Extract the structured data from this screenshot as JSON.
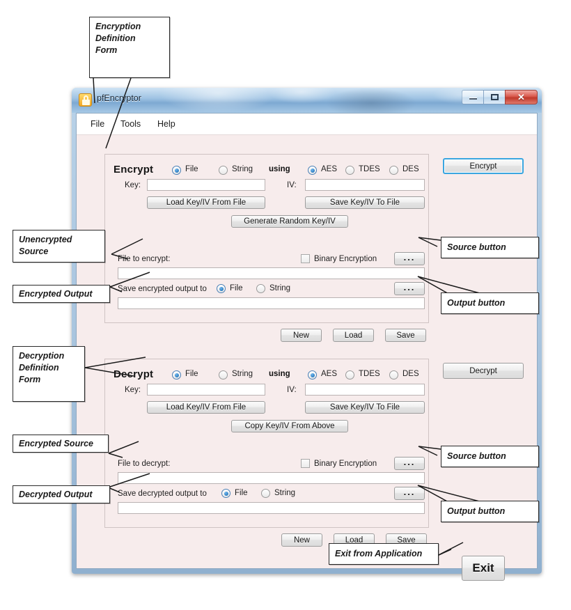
{
  "window": {
    "title": "pfEncryptor",
    "icon": "padlock-icon",
    "controls": {
      "minimize": "–",
      "maximize": "□",
      "close": "✕"
    }
  },
  "menubar": {
    "items": [
      "File",
      "Tools",
      "Help"
    ]
  },
  "encrypt_section": {
    "title": "Encrypt",
    "using_label": "using",
    "source_mode": {
      "options": [
        "File",
        "String"
      ],
      "selected": "File"
    },
    "algorithm": {
      "options": [
        "AES",
        "TDES",
        "DES"
      ],
      "selected": "AES"
    },
    "key_label": "Key:",
    "key_value": "",
    "iv_label": "IV:",
    "iv_value": "",
    "load_key_button": "Load Key/IV From File",
    "save_key_button": "Save Key/IV To File",
    "generate_button": "Generate Random Key/IV",
    "file_label": "File to encrypt:",
    "file_value": "",
    "binary_checkbox_label": "Binary Encryption",
    "binary_checked": false,
    "source_browse_button": "...",
    "output_label": "Save encrypted output to",
    "output_mode": {
      "options": [
        "File",
        "String"
      ],
      "selected": "File"
    },
    "output_value": "",
    "output_browse_button": "...",
    "new_button": "New",
    "load_button": "Load",
    "save_button": "Save",
    "action_button": "Encrypt"
  },
  "decrypt_section": {
    "title": "Decrypt",
    "using_label": "using",
    "source_mode": {
      "options": [
        "File",
        "String"
      ],
      "selected": "File"
    },
    "algorithm": {
      "options": [
        "AES",
        "TDES",
        "DES"
      ],
      "selected": "AES"
    },
    "key_label": "Key:",
    "key_value": "",
    "iv_label": "IV:",
    "iv_value": "",
    "load_key_button": "Load Key/IV From File",
    "save_key_button": "Save Key/IV To File",
    "copy_button": "Copy Key/IV From Above",
    "file_label": "File to decrypt:",
    "file_value": "",
    "binary_checkbox_label": "Binary Encryption",
    "binary_checked": false,
    "source_browse_button": "...",
    "output_label": "Save decrypted output to",
    "output_mode": {
      "options": [
        "File",
        "String"
      ],
      "selected": "File"
    },
    "output_value": "",
    "output_browse_button": "...",
    "new_button": "New",
    "load_button": "Load",
    "save_button": "Save",
    "action_button": "Decrypt"
  },
  "exit_button": "Exit",
  "annotations": {
    "encryption_definition_form": "Encryption\nDefinition\nForm",
    "encryption_definition_form_lines": [
      "Encryption",
      "Definition",
      "Form"
    ],
    "unencrypted_source_lines": [
      "Unencrypted",
      "Source"
    ],
    "encrypted_output": "Encrypted Output",
    "encrypt_source_button": "Source button",
    "encrypt_output_button": "Output button",
    "decryption_definition_form_lines": [
      "Decryption",
      "Definition",
      "Form"
    ],
    "encrypted_source": "Encrypted Source",
    "decrypted_output": "Decrypted Output",
    "decrypt_source_button": "Source button",
    "decrypt_output_button": "Output button",
    "exit_from_application": "Exit from Application"
  },
  "colors": {
    "window_chrome": "#a8c4de",
    "client_background": "#f7ecec",
    "focus_accent": "#3aa6e0",
    "close_button": "#c0392b",
    "app_icon": "#f2a825"
  }
}
